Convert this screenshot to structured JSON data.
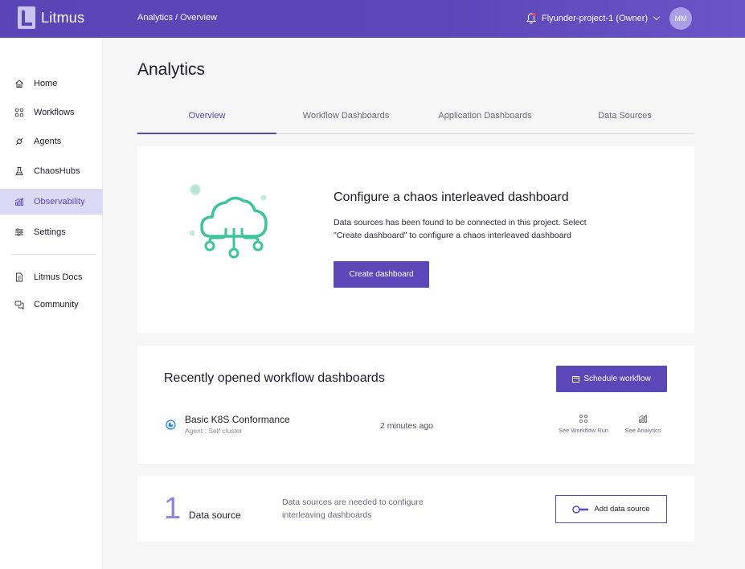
{
  "header": {
    "logo_text": "Litmus",
    "breadcrumb": "Analytics / Overview",
    "project": "Flyunder-project-1 (Owner)",
    "avatar_initials": "MM"
  },
  "sidebar": {
    "items": [
      {
        "label": "Home",
        "icon": "home-icon"
      },
      {
        "label": "Workflows",
        "icon": "workflows-icon"
      },
      {
        "label": "Agents",
        "icon": "agents-icon"
      },
      {
        "label": "ChaosHubs",
        "icon": "chaoshubs-icon"
      },
      {
        "label": "Observability",
        "icon": "observability-icon",
        "active": true
      },
      {
        "label": "Settings",
        "icon": "settings-icon"
      }
    ],
    "links": [
      {
        "label": "Litmus Docs",
        "icon": "docs-icon"
      },
      {
        "label": "Community",
        "icon": "community-icon"
      }
    ]
  },
  "main": {
    "title": "Analytics",
    "tabs": [
      {
        "label": "Overview",
        "active": true
      },
      {
        "label": "Workflow Dashboards"
      },
      {
        "label": "Application Dashboards"
      },
      {
        "label": "Data Sources"
      }
    ],
    "configure": {
      "title": "Configure a chaos interleaved dashboard",
      "description": "Data sources has been found to be connected in this project. Select \"Create dashboard\" to configure a chaos interleaved dashboard",
      "button": "Create dashboard"
    },
    "recent": {
      "title": "Recently opened workflow dashboards",
      "schedule_button": "Schedule workflow",
      "rows": [
        {
          "name": "Basic K8S Conformance",
          "agent": "Agent : Self cluster",
          "time": "2 minutes ago",
          "action1": "See Workflow Run",
          "action2": "See Analytics"
        }
      ]
    },
    "datasource": {
      "count": "1",
      "label": "Data source",
      "description": "Data sources are needed to configure interleaving dashboards",
      "button": "Add data source"
    }
  },
  "colors": {
    "brand": "#5b47b8",
    "active_nav_bg": "#dcd9f4",
    "cloud": "#3ec49a"
  }
}
